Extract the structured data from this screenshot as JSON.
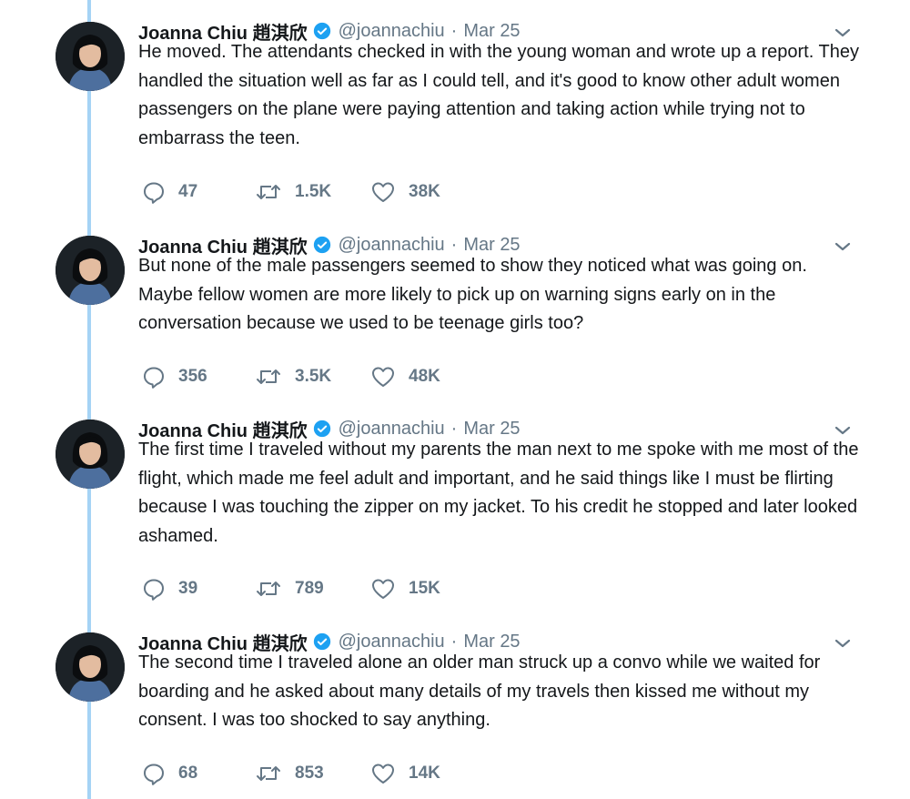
{
  "tweets": [
    {
      "name": "Joanna Chiu 趙淇欣",
      "handle": "@joannachiu",
      "date": "Mar 25",
      "text": "He moved. The attendants checked in with the young woman and wrote up a report. They handled the situation well as far as I could tell, and it's good to know other adult women passengers on the plane were paying attention and taking action while trying not to embarrass the teen.",
      "replies": "47",
      "retweets": "1.5K",
      "likes": "38K"
    },
    {
      "name": "Joanna Chiu 趙淇欣",
      "handle": "@joannachiu",
      "date": "Mar 25",
      "text": "But none of the male passengers seemed to show they noticed what was going on. Maybe fellow women are more likely to pick up on warning signs early on in the conversation because we used to be teenage girls too?",
      "replies": "356",
      "retweets": "3.5K",
      "likes": "48K"
    },
    {
      "name": "Joanna Chiu 趙淇欣",
      "handle": "@joannachiu",
      "date": "Mar 25",
      "text": "The first time I traveled without my parents the man next to me spoke with me most of the flight, which made me feel adult and important, and he said things like I must be flirting because I was touching the zipper on my jacket. To his credit he stopped and later looked ashamed.",
      "replies": "39",
      "retweets": "789",
      "likes": "15K"
    },
    {
      "name": "Joanna Chiu 趙淇欣",
      "handle": "@joannachiu",
      "date": "Mar 25",
      "text": "The second time I traveled alone an older man struck up a convo while we waited for boarding and he asked about many details of my travels then kissed me without my consent. I was too shocked to say anything.",
      "replies": "68",
      "retweets": "853",
      "likes": "14K"
    }
  ],
  "icons": {
    "reply": "reply-icon",
    "retweet": "retweet-icon",
    "like": "heart-icon",
    "verified": "verified-badge-icon",
    "caret": "chevron-down-icon"
  },
  "colors": {
    "thread_line": "#a5d3f5",
    "verified": "#1da1f2",
    "secondary_text": "#657786",
    "primary_text": "#14171a"
  }
}
